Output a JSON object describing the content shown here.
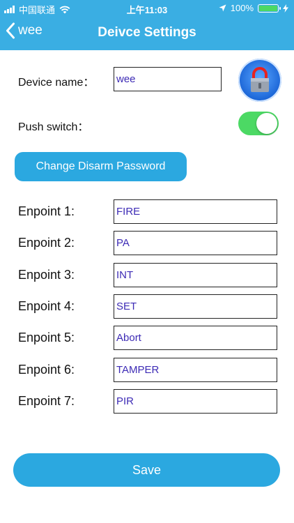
{
  "status_bar": {
    "carrier": "中国联通",
    "time": "上午11:03",
    "battery": "100%"
  },
  "nav": {
    "back_label": "wee",
    "title": "Deivce Settings"
  },
  "form": {
    "device_name_label": "Device name：",
    "device_name_value": "wee",
    "push_switch_label": "Push switch：",
    "push_switch_on": true,
    "change_password_label": "Change Disarm Password"
  },
  "endpoints": [
    {
      "label": "Enpoint 1:",
      "value": "FIRE"
    },
    {
      "label": "Enpoint 2:",
      "value": "PA"
    },
    {
      "label": "Enpoint 3:",
      "value": "INT"
    },
    {
      "label": "Enpoint 4:",
      "value": "SET"
    },
    {
      "label": "Enpoint 5:",
      "value": "Abort"
    },
    {
      "label": "Enpoint 6:",
      "value": "TAMPER"
    },
    {
      "label": "Enpoint 7:",
      "value": "PIR"
    }
  ],
  "save_label": "Save",
  "colors": {
    "header": "#3aaee3",
    "button": "#2ba8e0",
    "switch_on": "#4cd964",
    "input_text": "#3d2bb5"
  }
}
